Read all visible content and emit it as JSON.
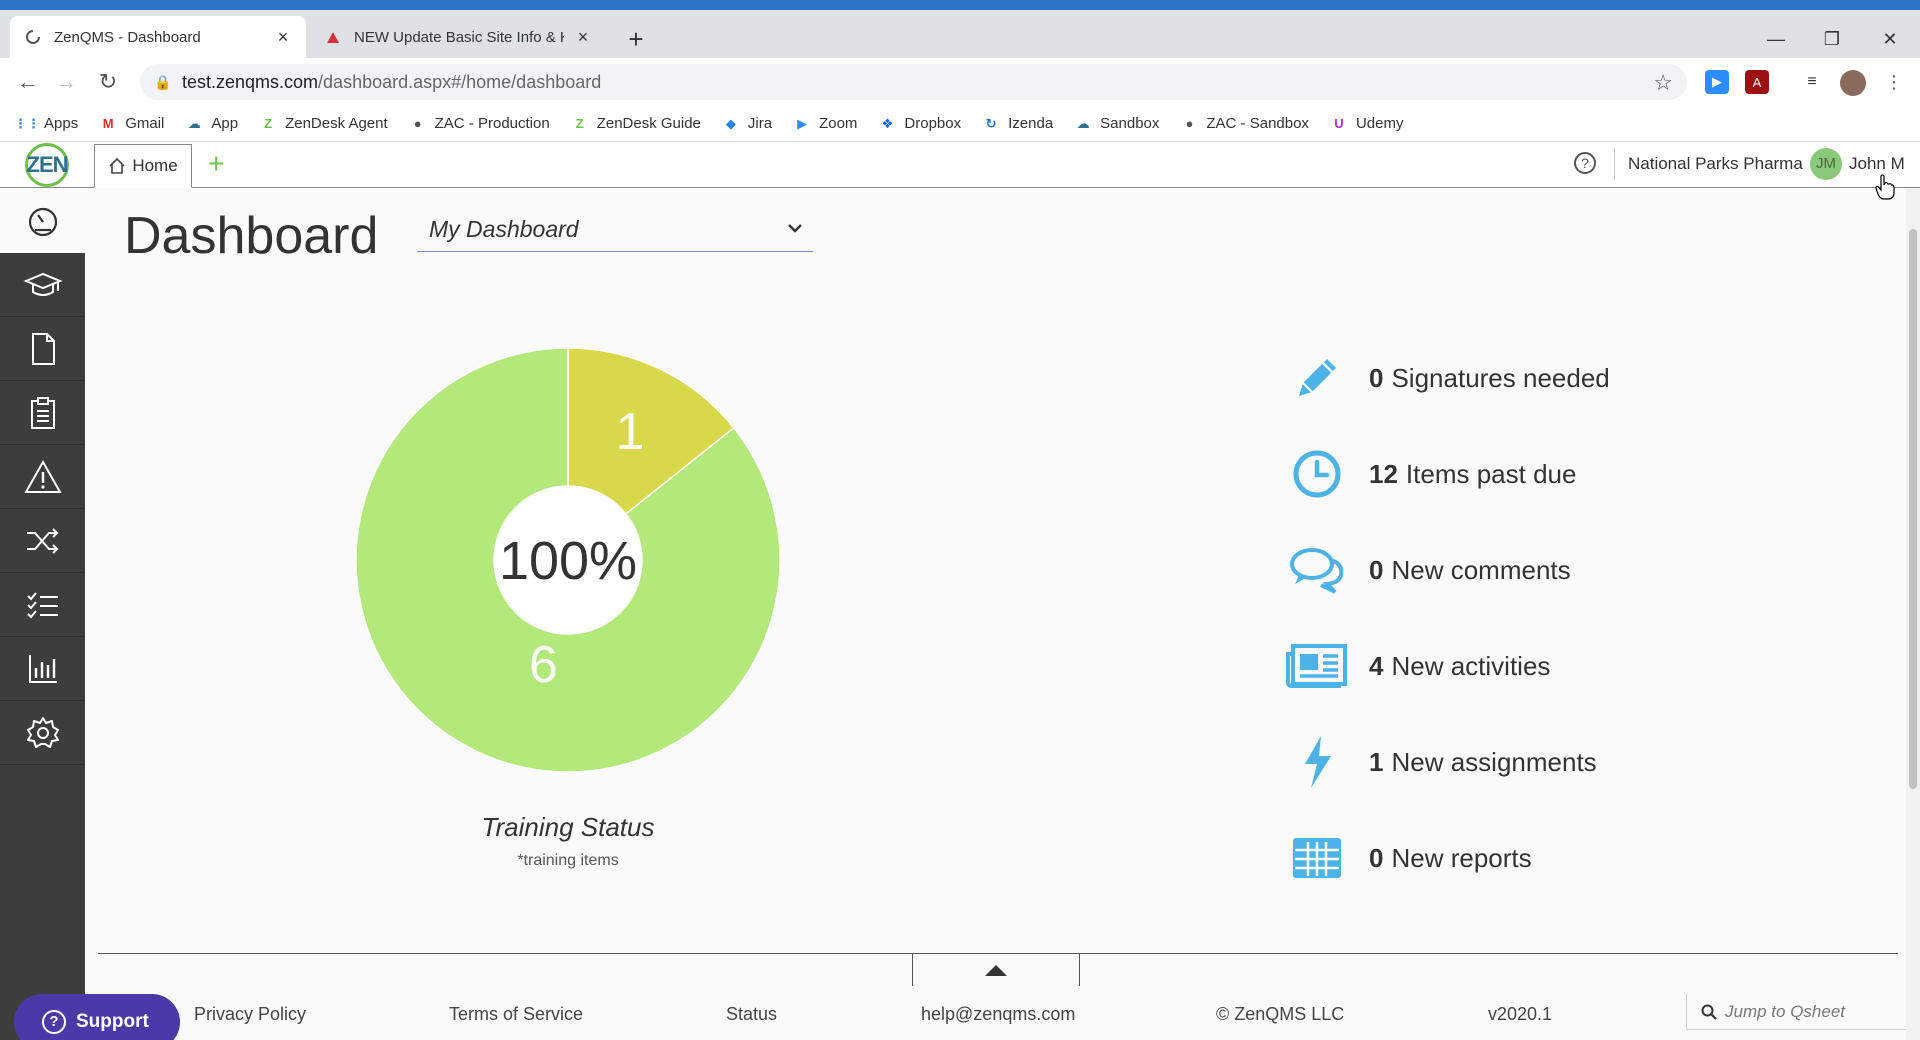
{
  "browser": {
    "tabs": [
      {
        "title": "ZenQMS - Dashboard",
        "active": true
      },
      {
        "title": "NEW Update Basic Site Info & Ke",
        "active": false
      }
    ],
    "url": {
      "host": "test.zenqms.com",
      "path": "/dashboard.aspx#/home/dashboard"
    },
    "bookmarks": [
      {
        "label": "Apps",
        "icon": "apps-grid-icon",
        "color": "#4285f4"
      },
      {
        "label": "Gmail",
        "icon": "gmail-icon",
        "color": "#d93025"
      },
      {
        "label": "App",
        "icon": "cloud-icon",
        "color": "#2f6f8f"
      },
      {
        "label": "ZenDesk Agent",
        "icon": "zendesk-icon",
        "color": "#6cc04a"
      },
      {
        "label": "ZAC - Production",
        "icon": "globe-icon",
        "color": "#555555"
      },
      {
        "label": "ZenDesk Guide",
        "icon": "zendesk-icon",
        "color": "#6cc04a"
      },
      {
        "label": "Jira",
        "icon": "jira-icon",
        "color": "#2684ff"
      },
      {
        "label": "Zoom",
        "icon": "zoom-icon",
        "color": "#2d8cff"
      },
      {
        "label": "Dropbox",
        "icon": "dropbox-icon",
        "color": "#0061ff"
      },
      {
        "label": "Izenda",
        "icon": "izenda-icon",
        "color": "#1e6fd9"
      },
      {
        "label": "Sandbox",
        "icon": "cloud-icon",
        "color": "#2f6f8f"
      },
      {
        "label": "ZAC - Sandbox",
        "icon": "globe-icon",
        "color": "#555555"
      },
      {
        "label": "Udemy",
        "icon": "udemy-icon",
        "color": "#a435f0"
      }
    ]
  },
  "app": {
    "logo_text": "ZEN",
    "home_tab": "Home",
    "organization": "National Parks Pharma",
    "user": {
      "initials": "JM",
      "name": "John M"
    }
  },
  "sidebar": {
    "items": [
      {
        "name": "dashboard",
        "icon": "speedometer-icon",
        "active": true
      },
      {
        "name": "training",
        "icon": "graduation-cap-icon",
        "active": false
      },
      {
        "name": "documents",
        "icon": "document-icon",
        "active": false
      },
      {
        "name": "audits",
        "icon": "clipboard-icon",
        "active": false
      },
      {
        "name": "events",
        "icon": "warning-icon",
        "active": false
      },
      {
        "name": "change-control",
        "icon": "shuffle-icon",
        "active": false
      },
      {
        "name": "tasks",
        "icon": "checklist-icon",
        "active": false
      },
      {
        "name": "reports",
        "icon": "bar-chart-icon",
        "active": false
      },
      {
        "name": "settings",
        "icon": "gear-icon",
        "active": false
      }
    ]
  },
  "main": {
    "title": "Dashboard",
    "dashboard_select": "My Dashboard",
    "chart_title": "Training Status",
    "chart_subtitle": "*training items",
    "center_label": "100%",
    "stats": [
      {
        "count": "0",
        "label": "Signatures needed",
        "icon": "pencil-icon"
      },
      {
        "count": "12",
        "label": "Items past due",
        "icon": "clock-icon"
      },
      {
        "count": "0",
        "label": "New comments",
        "icon": "chat-bubbles-icon"
      },
      {
        "count": "4",
        "label": "New activities",
        "icon": "newspaper-icon"
      },
      {
        "count": "1",
        "label": "New assignments",
        "icon": "lightning-icon"
      },
      {
        "count": "0",
        "label": "New reports",
        "icon": "table-grid-icon"
      }
    ],
    "accent_color": "#4db3e6"
  },
  "chart_data": {
    "type": "pie",
    "title": "Training Status",
    "subtitle": "*training items",
    "categories": [
      "",
      ""
    ],
    "values": [
      6,
      1
    ],
    "colors": [
      "#b3e97a",
      "#d9d84a"
    ],
    "center_label": "100%"
  },
  "footer": {
    "support": "Support",
    "links": [
      "Privacy Policy",
      "Terms of Service",
      "Status",
      "help@zenqms.com",
      "© ZenQMS LLC",
      "v2020.1"
    ],
    "search_placeholder": "Jump to Qsheet"
  }
}
